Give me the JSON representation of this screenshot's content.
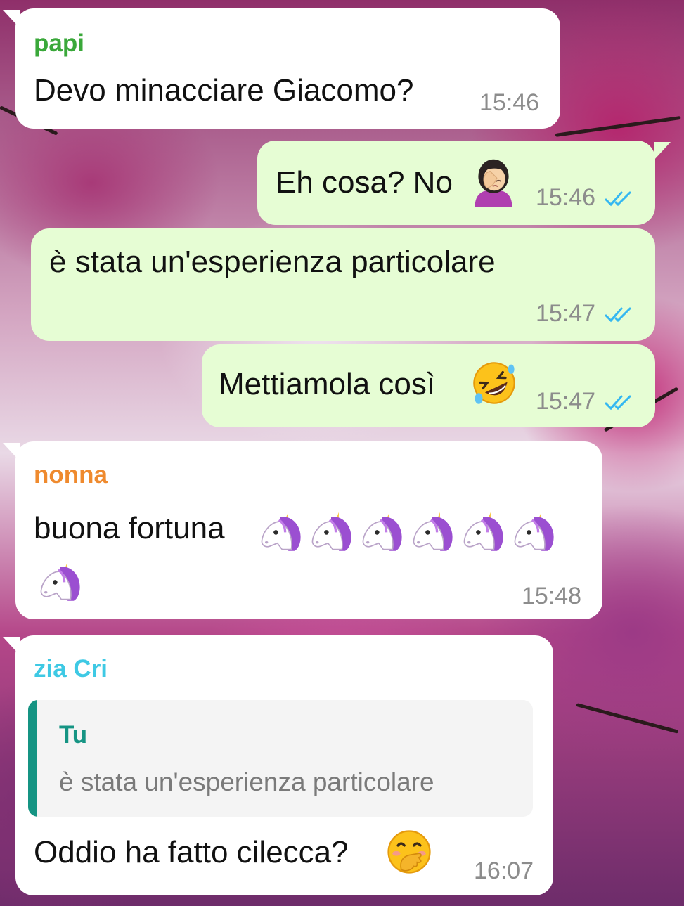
{
  "colors": {
    "incoming_bubble": "#ffffff",
    "outgoing_bubble": "#e6fdd4",
    "read_ticks": "#34b7f1",
    "sender_papi": "#3aa83a",
    "sender_nonna": "#ef8a2e",
    "sender_zia": "#3ec9e4",
    "quote_author": "#159483"
  },
  "messages": [
    {
      "type": "incoming",
      "sender": "papi",
      "text": "Devo minacciare Giacomo?",
      "time": "15:46"
    },
    {
      "type": "outgoing",
      "text": "Eh cosa? No",
      "emoji": "woman-facepalming-icon",
      "time": "15:46",
      "status": "read"
    },
    {
      "type": "outgoing",
      "text": "è stata un'esperienza particolare",
      "time": "15:47",
      "status": "read"
    },
    {
      "type": "outgoing",
      "text": "Mettiamola così",
      "emoji": "rolling-on-floor-laughing-icon",
      "time": "15:47",
      "status": "read"
    },
    {
      "type": "incoming",
      "sender": "nonna",
      "text": "buona fortuna",
      "emoji": "unicorn-icon",
      "emoji_count": 7,
      "time": "15:48"
    },
    {
      "type": "incoming",
      "sender": "zia Cri",
      "quote": {
        "author": "Tu",
        "text": "è stata un'esperienza particolare"
      },
      "text": "Oddio ha fatto cilecca?",
      "emoji": "hand-over-mouth-icon",
      "time": "16:07"
    }
  ]
}
